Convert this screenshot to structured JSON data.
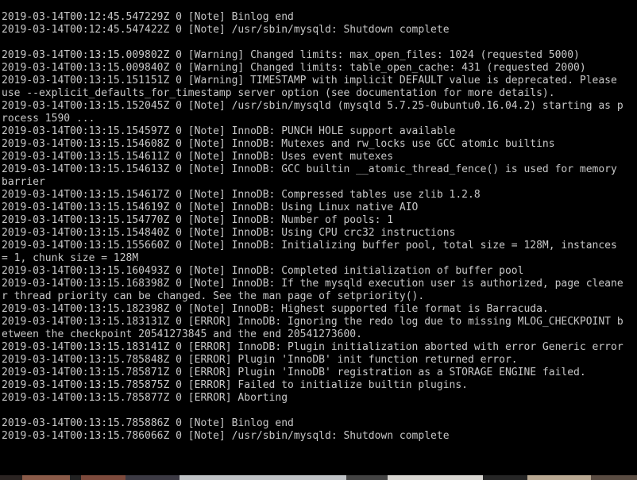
{
  "terminal": {
    "lines": [
      "2019-03-14T00:12:45.547229Z 0 [Note] Binlog end",
      "2019-03-14T00:12:45.547422Z 0 [Note] /usr/sbin/mysqld: Shutdown complete",
      "",
      "2019-03-14T00:13:15.009802Z 0 [Warning] Changed limits: max_open_files: 1024 (requested 5000)",
      "2019-03-14T00:13:15.009840Z 0 [Warning] Changed limits: table_open_cache: 431 (requested 2000)",
      "2019-03-14T00:13:15.151151Z 0 [Warning] TIMESTAMP with implicit DEFAULT value is deprecated. Please",
      "use --explicit_defaults_for_timestamp server option (see documentation for more details).",
      "2019-03-14T00:13:15.152045Z 0 [Note] /usr/sbin/mysqld (mysqld 5.7.25-0ubuntu0.16.04.2) starting as p",
      "rocess 1590 ...",
      "2019-03-14T00:13:15.154597Z 0 [Note] InnoDB: PUNCH HOLE support available",
      "2019-03-14T00:13:15.154608Z 0 [Note] InnoDB: Mutexes and rw_locks use GCC atomic builtins",
      "2019-03-14T00:13:15.154611Z 0 [Note] InnoDB: Uses event mutexes",
      "2019-03-14T00:13:15.154613Z 0 [Note] InnoDB: GCC builtin __atomic_thread_fence() is used for memory",
      "barrier",
      "2019-03-14T00:13:15.154617Z 0 [Note] InnoDB: Compressed tables use zlib 1.2.8",
      "2019-03-14T00:13:15.154619Z 0 [Note] InnoDB: Using Linux native AIO",
      "2019-03-14T00:13:15.154770Z 0 [Note] InnoDB: Number of pools: 1",
      "2019-03-14T00:13:15.154840Z 0 [Note] InnoDB: Using CPU crc32 instructions",
      "2019-03-14T00:13:15.155660Z 0 [Note] InnoDB: Initializing buffer pool, total size = 128M, instances",
      "= 1, chunk size = 128M",
      "2019-03-14T00:13:15.160493Z 0 [Note] InnoDB: Completed initialization of buffer pool",
      "2019-03-14T00:13:15.168398Z 0 [Note] InnoDB: If the mysqld execution user is authorized, page cleane",
      "r thread priority can be changed. See the man page of setpriority().",
      "2019-03-14T00:13:15.182398Z 0 [Note] InnoDB: Highest supported file format is Barracuda.",
      "2019-03-14T00:13:15.183131Z 0 [ERROR] InnoDB: Ignoring the redo log due to missing MLOG_CHECKPOINT b",
      "etween the checkpoint 20541273845 and the end 20541273600.",
      "2019-03-14T00:13:15.183141Z 0 [ERROR] InnoDB: Plugin initialization aborted with error Generic error",
      "2019-03-14T00:13:15.785848Z 0 [ERROR] Plugin 'InnoDB' init function returned error.",
      "2019-03-14T00:13:15.785871Z 0 [ERROR] Plugin 'InnoDB' registration as a STORAGE ENGINE failed.",
      "2019-03-14T00:13:15.785875Z 0 [ERROR] Failed to initialize builtin plugins.",
      "2019-03-14T00:13:15.785877Z 0 [ERROR] Aborting",
      "",
      "2019-03-14T00:13:15.785886Z 0 [Note] Binlog end",
      "2019-03-14T00:13:15.786066Z 0 [Note] /usr/sbin/mysqld: Shutdown complete"
    ]
  },
  "colors": {
    "background": "#000000",
    "text": "#c8c8c8"
  }
}
